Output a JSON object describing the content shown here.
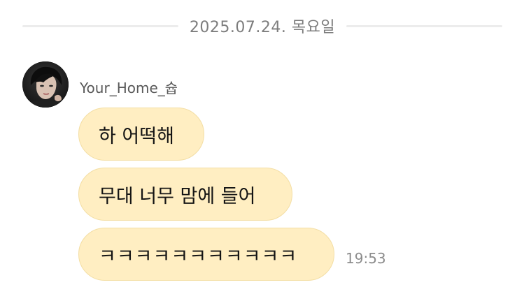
{
  "date_divider": {
    "text": "2025.07.24. 목요일"
  },
  "sender": {
    "name": "Your_Home_슙"
  },
  "messages": [
    {
      "text": "하 어떡해"
    },
    {
      "text": "무대 너무 맘에 들어"
    },
    {
      "text": "ㅋㅋㅋㅋㅋㅋㅋㅋㅋㅋㅋ"
    }
  ],
  "last_message_time": "19:53",
  "colors": {
    "bubble_background": "#ffeec2",
    "bubble_border": "#f3dea4",
    "divider_line": "#ececec",
    "timestamp_text": "#8c8c8c"
  },
  "icons": {
    "avatar": "user-profile-photo"
  }
}
